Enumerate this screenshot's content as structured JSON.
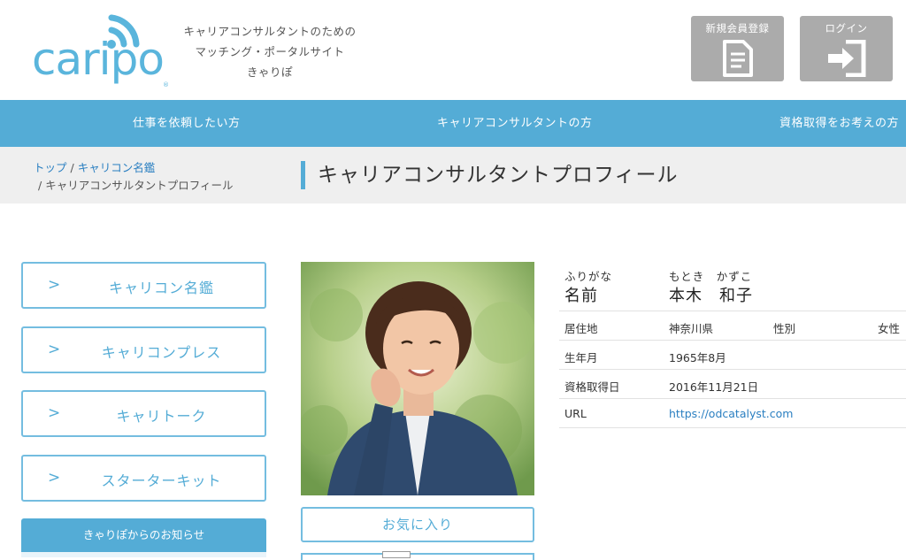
{
  "header": {
    "logo_text": "caripo",
    "tagline": [
      "キャリアコンサルタントのための",
      "マッチング・ポータルサイト",
      "きゃりぽ"
    ],
    "register_label": "新規会員登録",
    "login_label": "ログイン"
  },
  "nav": {
    "items": [
      {
        "label": "仕事を依頼したい方"
      },
      {
        "label": "キャリアコンサルタントの方"
      },
      {
        "label": "資格取得をお考えの方"
      }
    ]
  },
  "breadcrumb": {
    "home": "トップ",
    "sep": "/",
    "directory": "キャリコン名鑑",
    "current": "キャリアコンサルタントプロフィール"
  },
  "page_title": "キャリアコンサルタントプロフィール",
  "sidebar": {
    "chevron": ">",
    "items": [
      {
        "label": "キャリコン名鑑"
      },
      {
        "label": "キャリコンプレス"
      },
      {
        "label": "キャリトーク"
      },
      {
        "label": "スターターキット"
      }
    ],
    "notice_label": "きゃりぽからのお知らせ"
  },
  "favorite_label": "お気に入り",
  "profile": {
    "furigana_label": "ふりがな",
    "furigana_value": "もとき　かずこ",
    "name_label": "名前",
    "name_value": "本木　和子",
    "residence_label": "居住地",
    "residence_value": "神奈川県",
    "gender_label": "性別",
    "gender_value": "女性",
    "birth_label": "生年月",
    "birth_value": "1965年8月",
    "license_label": "資格取得日",
    "license_value": "2016年11月21日",
    "url_label": "URL",
    "url_value": "https://odcatalyst.com"
  },
  "colors": {
    "accent": "#54acd6",
    "logo": "#5ab5dc",
    "header_button": "#ababab",
    "band": "#efefef",
    "link": "#2a7fc1"
  }
}
